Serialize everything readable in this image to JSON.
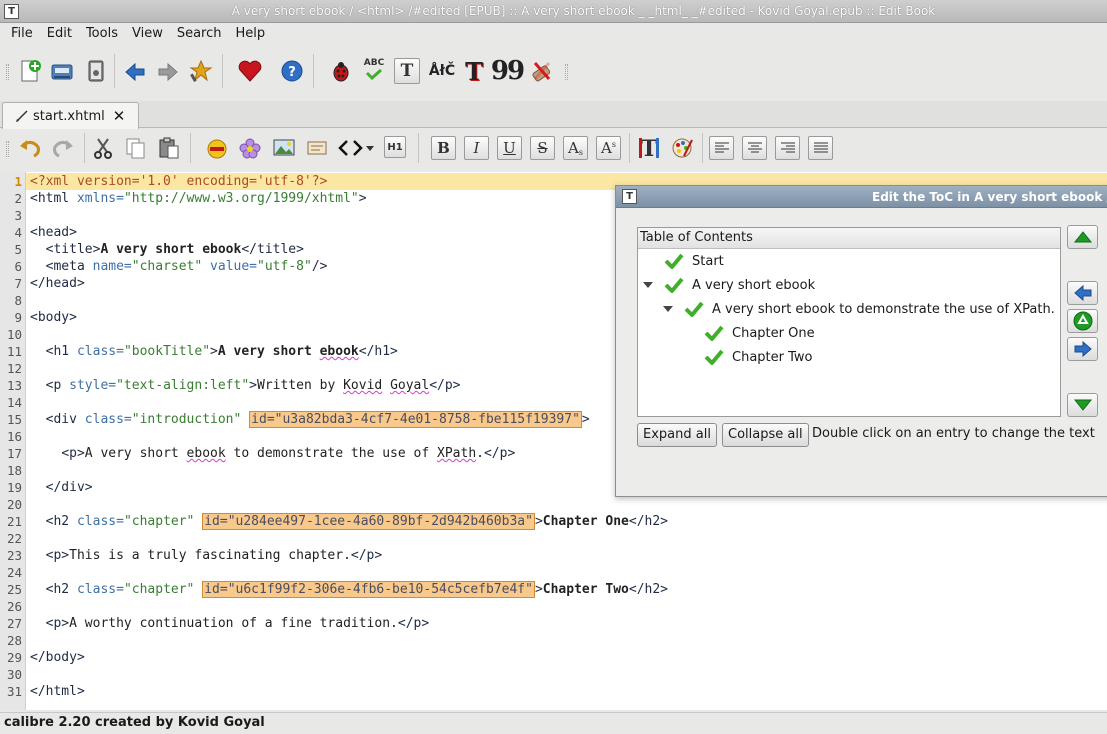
{
  "window": {
    "title": "A very short ebook / <html> /#edited [EPUB] :: A very short ebook _ _html_ _#edited - Kovid Goyal.epub :: Edit Book"
  },
  "menu": [
    "File",
    "Edit",
    "Tools",
    "View",
    "Search",
    "Help"
  ],
  "toolbar_main": {
    "icons": [
      "new-file-icon",
      "save-icon",
      "book-icon",
      "back-icon",
      "forward-icon",
      "checkpoint-icon",
      "donate-heart-icon",
      "help-icon",
      "check-book-icon",
      "spell-check-icon",
      "reports-icon",
      "smarten-punctuation-icon",
      "fonts-icon",
      "quote-icon",
      "remove-unused-css-icon"
    ],
    "label_spell": "ABC",
    "label_t": "T",
    "label_alc": "ÅłČ",
    "label_quote": "99"
  },
  "tabs": [
    {
      "label": "start.xhtml",
      "active": true
    }
  ],
  "toolbar_editor": {
    "format_buttons": [
      "B",
      "I",
      "U",
      "S",
      "A",
      "A"
    ],
    "h1_label": "H1"
  },
  "editor": {
    "current_line": 1,
    "line_numbers": [
      "1",
      "2",
      "3",
      "4",
      "5",
      "6",
      "7",
      "8",
      "9",
      "10",
      "11",
      "12",
      "13",
      "14",
      "15",
      "16",
      "17",
      "18",
      "19",
      "20",
      "21",
      "22",
      "23",
      "24",
      "25",
      "26",
      "27",
      "28",
      "29",
      "30",
      "31"
    ],
    "lines": {
      "l1": "<?xml version='1.0' encoding='utf-8'?>",
      "l2_tag": "<html ",
      "l2_attr": "xmlns=",
      "l2_val": "\"http://www.w3.org/1999/xhtml\"",
      "l2_end": ">",
      "l4": "<head>",
      "l5_open": "<title>",
      "l5_text": "A very short ebook",
      "l5_close": "</title>",
      "l6_tag": "<meta ",
      "l6_a1": "name=",
      "l6_v1": "\"charset\"",
      "l6_a2": " value=",
      "l6_v2": "\"utf-8\"",
      "l6_end": "/>",
      "l7": "</head>",
      "l9": "<body>",
      "l11_tag": "<h1 ",
      "l11_attr": "class=",
      "l11_val": "\"bookTitle\"",
      "l11_gt": ">",
      "l11_text_a": "A very short ",
      "l11_text_b": "ebook",
      "l11_close": "</h1>",
      "l13_tag": "<p ",
      "l13_attr": "style=",
      "l13_val": "\"text-align:left\"",
      "l13_gt": ">",
      "l13_text_a": "Written by ",
      "l13_text_b": "Kovid",
      "l13_text_c": " ",
      "l13_text_d": "Goyal",
      "l13_close": "</p>",
      "l15_tag": "<div ",
      "l15_attr": "class=",
      "l15_val": "\"introduction\"",
      "l15_id": "id=\"u3a82bda3-4cf7-4e01-8758-fbe115f19397\"",
      "l15_gt": ">",
      "l17_open": "<p>",
      "l17_text_a": "A very short ",
      "l17_text_b": "ebook",
      "l17_text_c": " to demonstrate the use of ",
      "l17_text_d": "XPath",
      "l17_text_e": ".",
      "l17_close": "</p>",
      "l19": "</div>",
      "l21_tag": "<h2 ",
      "l21_attr": "class=",
      "l21_val": "\"chapter\"",
      "l21_id": "id=\"u284ee497-1cee-4a60-89bf-2d942b460b3a\"",
      "l21_gt": ">",
      "l21_text": "Chapter One",
      "l21_close": "</h2>",
      "l23_open": "<p>",
      "l23_text": "This is a truly fascinating chapter.",
      "l23_close": "</p>",
      "l25_tag": "<h2 ",
      "l25_attr": "class=",
      "l25_val": "\"chapter\"",
      "l25_id": "id=\"u6c1f99f2-306e-4fb6-be10-54c5cefb7e4f\"",
      "l25_gt": ">",
      "l25_text": "Chapter Two",
      "l25_close": "</h2>",
      "l27_open": "<p>",
      "l27_text": "A worthy continuation of a fine tradition.",
      "l27_close": "</p>",
      "l29": "</body>",
      "l31": "</html>"
    }
  },
  "status": "calibre 2.20 created by Kovid Goyal",
  "toc_dialog": {
    "title": "Edit the ToC in A very short ebook / <htm",
    "header": "Table of Contents",
    "entries": [
      {
        "label": "Start",
        "depth": 0
      },
      {
        "label": "A very short ebook",
        "depth": 0,
        "expanded": true
      },
      {
        "label": "A very short ebook to demonstrate the use of XPath.",
        "depth": 1,
        "expanded": true
      },
      {
        "label": "Chapter One",
        "depth": 2
      },
      {
        "label": "Chapter Two",
        "depth": 2
      }
    ],
    "expand_all": "Expand all",
    "collapse_all": "Collapse all",
    "hint": "Double click on an entry to change the text"
  },
  "colors": {
    "check_green": "#3fae2a",
    "current_line": "#fbe7a3",
    "id_highlight": "#f8c98a",
    "arrow_blue": "#2f6fc4",
    "arrow_green": "#1f9a25"
  }
}
